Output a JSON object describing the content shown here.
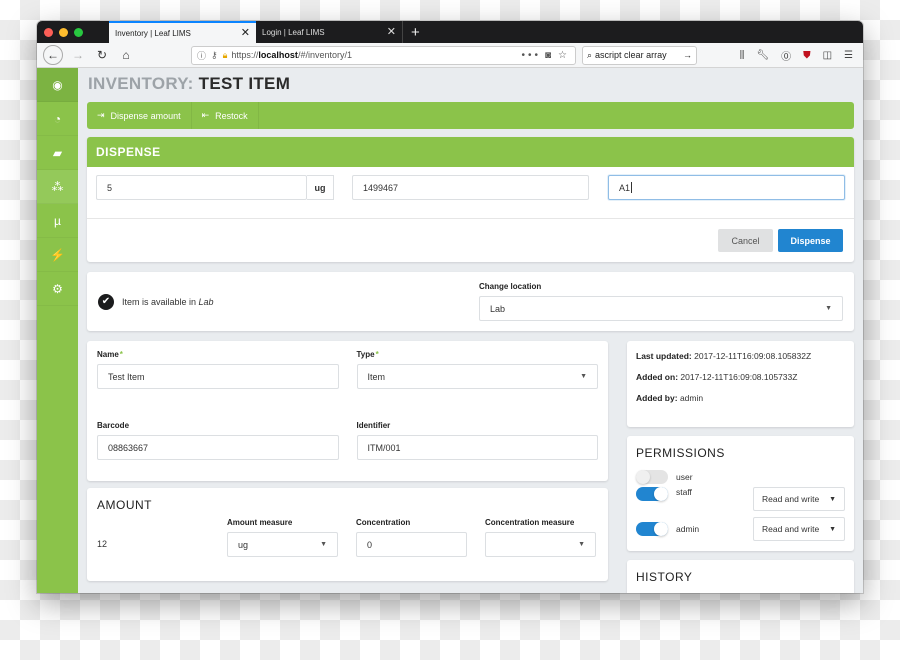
{
  "browser": {
    "tabs": [
      {
        "label": "Inventory | Leaf LIMS",
        "active": true
      },
      {
        "label": "Login | Leaf LIMS",
        "active": false
      }
    ],
    "new_tab_icon": "plus-icon",
    "url_prefix": "https://",
    "url_host": "localhost",
    "url_path": "/#/inventory/1",
    "search_value": "ascript clear array",
    "page_actions": "•••"
  },
  "sidebar": {
    "items": [
      {
        "icon": "user-circle-icon",
        "glyph": "◉"
      },
      {
        "icon": "dashboard-icon",
        "glyph": "◔"
      },
      {
        "icon": "book-icon",
        "glyph": "▰"
      },
      {
        "icon": "cubes-icon",
        "glyph": "⁂"
      },
      {
        "icon": "mu-icon",
        "glyph": "µ"
      },
      {
        "icon": "plug-icon",
        "glyph": "⚡"
      },
      {
        "icon": "cogs-icon",
        "glyph": "⚙"
      }
    ]
  },
  "page": {
    "title_prefix": "INVENTORY:",
    "title": "TEST ITEM"
  },
  "actions": {
    "dispense_label": "Dispense amount",
    "restock_label": "Restock"
  },
  "dispense": {
    "title": "DISPENSE",
    "amount_value": "5",
    "amount_unit": "ug",
    "task_value": "1499467",
    "location_value": "A1",
    "cancel_label": "Cancel",
    "submit_label": "Dispense"
  },
  "location": {
    "availability_prefix": "Item is available in ",
    "availability_location": "Lab",
    "change_label": "Change location",
    "selected": "Lab"
  },
  "details": {
    "name_label": "Name",
    "name_value": "Test Item",
    "type_label": "Type",
    "type_value": "Item",
    "barcode_label": "Barcode",
    "barcode_value": "08863667",
    "identifier_label": "Identifier",
    "identifier_value": "ITM/001",
    "required_marker": "*"
  },
  "amount": {
    "title": "AMOUNT",
    "value": "12",
    "measure_label": "Amount measure",
    "measure_value": "ug",
    "concentration_label": "Concentration",
    "concentration_value": "0",
    "concentration_measure_label": "Concentration measure",
    "concentration_measure_value": ""
  },
  "meta": {
    "last_updated_label": "Last updated:",
    "last_updated_value": "2017-12-11T16:09:08.105832Z",
    "added_on_label": "Added on:",
    "added_on_value": "2017-12-11T16:09:08.105733Z",
    "added_by_label": "Added by:",
    "added_by_value": "admin"
  },
  "permissions": {
    "title": "PERMISSIONS",
    "rows": [
      {
        "group": "user",
        "enabled": false,
        "level": null
      },
      {
        "group": "staff",
        "enabled": true,
        "level": "Read and write"
      },
      {
        "group": "admin",
        "enabled": true,
        "level": "Read and write"
      }
    ]
  },
  "history": {
    "title": "HISTORY"
  },
  "colors": {
    "brand_green": "#8bc34a",
    "primary_blue": "#2185d0"
  }
}
